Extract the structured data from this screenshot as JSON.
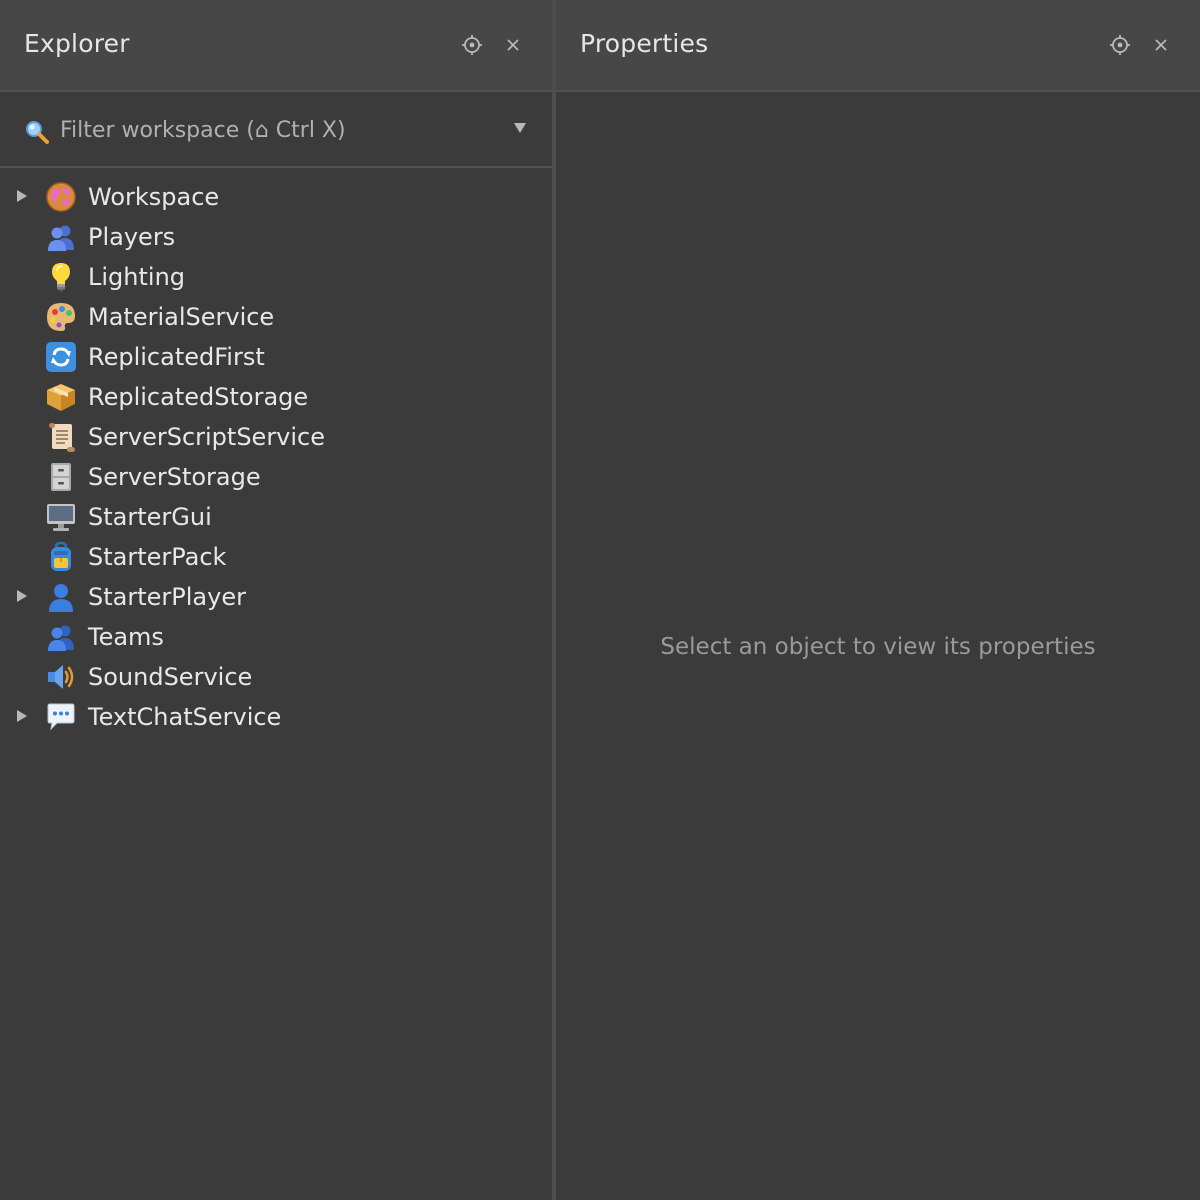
{
  "explorer": {
    "title": "Explorer",
    "filter": {
      "placeholder": "Filter workspace (⌂ Ctrl X)"
    },
    "items": [
      {
        "label": "Workspace",
        "icon": "globe-icon",
        "expandable": true
      },
      {
        "label": "Players",
        "icon": "players-icon",
        "expandable": false
      },
      {
        "label": "Lighting",
        "icon": "lightbulb-icon",
        "expandable": false
      },
      {
        "label": "MaterialService",
        "icon": "palette-icon",
        "expandable": false
      },
      {
        "label": "ReplicatedFirst",
        "icon": "refresh-arrows-icon",
        "expandable": false
      },
      {
        "label": "ReplicatedStorage",
        "icon": "package-box-icon",
        "expandable": false
      },
      {
        "label": "ServerScriptService",
        "icon": "scroll-icon",
        "expandable": false
      },
      {
        "label": "ServerStorage",
        "icon": "file-cabinet-icon",
        "expandable": false
      },
      {
        "label": "StarterGui",
        "icon": "monitor-icon",
        "expandable": false
      },
      {
        "label": "StarterPack",
        "icon": "backpack-icon",
        "expandable": false
      },
      {
        "label": "StarterPlayer",
        "icon": "person-icon",
        "expandable": true
      },
      {
        "label": "Teams",
        "icon": "team-icon",
        "expandable": false
      },
      {
        "label": "SoundService",
        "icon": "speaker-icon",
        "expandable": false
      },
      {
        "label": "TextChatService",
        "icon": "speech-bubble-icon",
        "expandable": true
      }
    ]
  },
  "properties": {
    "title": "Properties",
    "empty_message": "Select an object to view its properties"
  },
  "colors": {
    "panel_bg": "#3b3b3b",
    "header_bg": "#474747",
    "divider": "#525252",
    "text": "#e6e6e6",
    "muted_text": "#9a9a9a"
  }
}
